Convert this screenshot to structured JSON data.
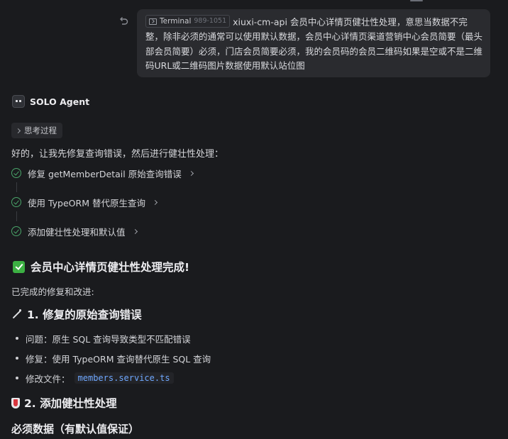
{
  "user_message": {
    "chip_label": "Terminal",
    "chip_range": "989-1051",
    "text": "xiuxi-cm-api 会员中心详情页健壮性处理，意思当数据不完整，除非必须的通常可以使用默认数据，会员中心详情页渠道营销中心会员简要（最头部会员简要）必须，门店会员简要必须，我的会员码的会员二维码如果是空或不是二维码URL或二维码图片数据使用默认站位图"
  },
  "agent": {
    "name": "SOLO Agent",
    "thinking_label": "思考过程",
    "intro": "好的，让我先修复查询错误，然后进行健壮性处理：",
    "steps": [
      {
        "label": "修复 getMemberDetail 原始查询错误"
      },
      {
        "label": "使用 TypeORM 替代原生查询"
      },
      {
        "label": "添加健壮性处理和默认值"
      }
    ]
  },
  "summary": {
    "heading": "会员中心详情页健壮性处理完成!",
    "subtitle": "已完成的修复和改进:",
    "section1": {
      "heading": "1. 修复的原始查询错误",
      "bullets": [
        "问题：原生 SQL 查询导致类型不匹配错误",
        "修复：使用 TypeORM 查询替代原生 SQL 查询",
        "修改文件："
      ],
      "file": "members.service.ts"
    },
    "section2": {
      "heading": "2. 添加健壮性处理"
    },
    "section3": {
      "heading": "必须数据（有默认值保证）"
    }
  },
  "colors": {
    "background": "#1a1b1e",
    "check_green": "#4aa56a",
    "code_blue": "#6fa8ff"
  }
}
